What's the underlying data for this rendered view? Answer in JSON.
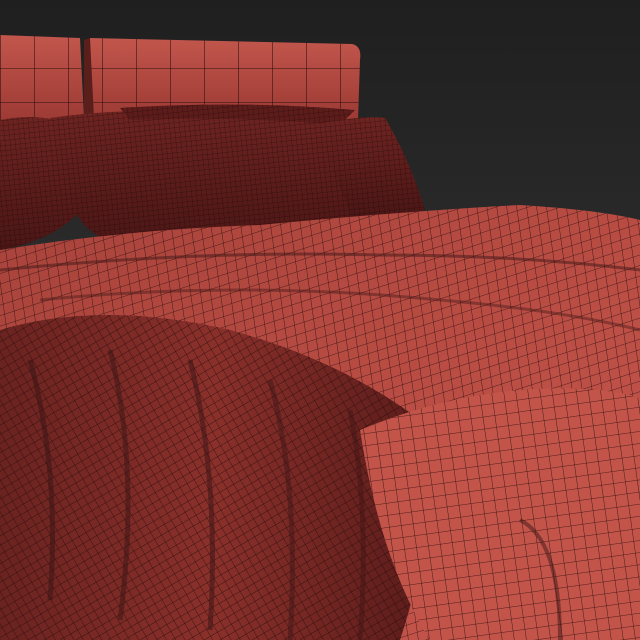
{
  "scene": {
    "subject": "bed-wireframe-render",
    "colors": {
      "background_top": "#1e1e1e",
      "background_bottom": "#3a3a3a",
      "surface": "#b5473f",
      "surface_dark": "#7a2a27",
      "surface_shadow": "#3d1515",
      "wire": "#2a0d0c"
    }
  }
}
